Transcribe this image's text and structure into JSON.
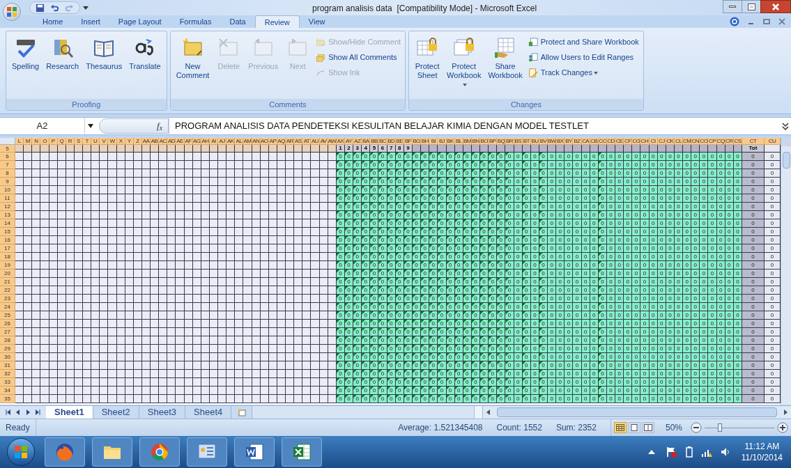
{
  "window": {
    "title": "program analisis data  [Compatibility Mode] - Microsoft Excel"
  },
  "ribbon_tabs": [
    {
      "label": "Home",
      "selected": false
    },
    {
      "label": "Insert",
      "selected": false
    },
    {
      "label": "Page Layout",
      "selected": false
    },
    {
      "label": "Formulas",
      "selected": false
    },
    {
      "label": "Data",
      "selected": false
    },
    {
      "label": "Review",
      "selected": true
    },
    {
      "label": "View",
      "selected": false
    }
  ],
  "groups": [
    {
      "label": "Proofing",
      "large": [
        {
          "label": "Spelling",
          "disabled": false,
          "dropdown": false
        },
        {
          "label": "Research",
          "disabled": false,
          "dropdown": false
        },
        {
          "label": "Thesaurus",
          "disabled": false,
          "dropdown": false
        },
        {
          "label": "Translate",
          "disabled": false,
          "dropdown": false
        }
      ]
    },
    {
      "label": "Comments",
      "large": [
        {
          "label": "New Comment",
          "disabled": false,
          "dropdown": false
        },
        {
          "label": "Delete",
          "disabled": true,
          "dropdown": false
        },
        {
          "label": "Previous",
          "disabled": true,
          "dropdown": false
        },
        {
          "label": "Next",
          "disabled": true,
          "dropdown": false
        }
      ],
      "small": [
        {
          "label": "Show/Hide Comment",
          "disabled": true,
          "dropdown": false
        },
        {
          "label": "Show All Comments",
          "disabled": false,
          "dropdown": false
        },
        {
          "label": "Show Ink",
          "disabled": true,
          "dropdown": false
        }
      ]
    },
    {
      "label": "Changes",
      "large": [
        {
          "label": "Protect Sheet",
          "disabled": false,
          "dropdown": false
        },
        {
          "label": "Protect Workbook",
          "disabled": false,
          "dropdown": true
        },
        {
          "label": "Share Workbook",
          "disabled": false,
          "dropdown": false
        }
      ],
      "small": [
        {
          "label": "Protect and Share Workbook",
          "disabled": false,
          "dropdown": false
        },
        {
          "label": "Allow Users to Edit Ranges",
          "disabled": false,
          "dropdown": false
        },
        {
          "label": "Track Changes",
          "disabled": false,
          "dropdown": true
        }
      ]
    }
  ],
  "formula_bar": {
    "name_box": "A2",
    "fx": "f$_{x}$",
    "value": "PROGRAM ANALISIS DATA PENDETEKSI KESULITAN BELAJAR KIMIA DENGAN MODEL TESTLET"
  },
  "grid": {
    "columns": [
      {
        "label": "L",
        "kind": "plain"
      },
      {
        "label": "M",
        "kind": "plain"
      },
      {
        "label": "N",
        "kind": "plain"
      },
      {
        "label": "O",
        "kind": "plain"
      },
      {
        "label": "P",
        "kind": "plain"
      },
      {
        "label": "Q",
        "kind": "plain"
      },
      {
        "label": "R",
        "kind": "plain"
      },
      {
        "label": "S",
        "kind": "plain"
      },
      {
        "label": "T",
        "kind": "plain"
      },
      {
        "label": "U",
        "kind": "plain"
      },
      {
        "label": "V",
        "kind": "plain"
      },
      {
        "label": "W",
        "kind": "plain"
      },
      {
        "label": "X",
        "kind": "plain"
      },
      {
        "label": "Y",
        "kind": "plain"
      },
      {
        "label": "Z",
        "kind": "plain"
      },
      {
        "label": "AA",
        "kind": "plain"
      },
      {
        "label": "AB",
        "kind": "plain"
      },
      {
        "label": "AC",
        "kind": "plain"
      },
      {
        "label": "AD",
        "kind": "plain"
      },
      {
        "label": "AE",
        "kind": "plain"
      },
      {
        "label": "AF",
        "kind": "plain"
      },
      {
        "label": "AG",
        "kind": "plain"
      },
      {
        "label": "AH",
        "kind": "plain"
      },
      {
        "label": "AI",
        "kind": "plain"
      },
      {
        "label": "AJ",
        "kind": "plain"
      },
      {
        "label": "AK",
        "kind": "plain"
      },
      {
        "label": "AL",
        "kind": "plain"
      },
      {
        "label": "AM",
        "kind": "plain"
      },
      {
        "label": "AN",
        "kind": "plain"
      },
      {
        "label": "AO",
        "kind": "plain"
      },
      {
        "label": "AP",
        "kind": "plain"
      },
      {
        "label": "AQ",
        "kind": "plain"
      },
      {
        "label": "AR",
        "kind": "plain"
      },
      {
        "label": "AS",
        "kind": "plain"
      },
      {
        "label": "AT",
        "kind": "plain"
      },
      {
        "label": "AU",
        "kind": "plain"
      },
      {
        "label": "AV",
        "kind": "plain"
      },
      {
        "label": "AW",
        "kind": "plain"
      },
      {
        "label": "AX",
        "kind": "answer",
        "flagged": true
      },
      {
        "label": "AY",
        "kind": "answer",
        "flagged": true
      },
      {
        "label": "AZ",
        "kind": "answer",
        "flagged": true
      },
      {
        "label": "BA",
        "kind": "answer",
        "flagged": true
      },
      {
        "label": "BB",
        "kind": "answer",
        "flagged": true
      },
      {
        "label": "BC",
        "kind": "answer",
        "flagged": true
      },
      {
        "label": "BD",
        "kind": "answer",
        "flagged": true
      },
      {
        "label": "BE",
        "kind": "answer",
        "flagged": true
      },
      {
        "label": "BF",
        "kind": "answer",
        "flagged": true
      },
      {
        "label": "BG",
        "kind": "answer",
        "flagged": true
      },
      {
        "label": "BH",
        "kind": "answer",
        "flagged": true
      },
      {
        "label": "BI",
        "kind": "answer",
        "flagged": true
      },
      {
        "label": "BJ",
        "kind": "answer",
        "flagged": true
      },
      {
        "label": "BK",
        "kind": "answer",
        "flagged": true
      },
      {
        "label": "BL",
        "kind": "answer",
        "flagged": true
      },
      {
        "label": "BM",
        "kind": "answer",
        "flagged": true
      },
      {
        "label": "BN",
        "kind": "answer",
        "flagged": true
      },
      {
        "label": "BO",
        "kind": "answer",
        "flagged": true
      },
      {
        "label": "BP",
        "kind": "answer",
        "flagged": true
      },
      {
        "label": "BQ",
        "kind": "answer",
        "flagged": true
      },
      {
        "label": "BR",
        "kind": "answer",
        "flagged": true
      },
      {
        "label": "BS",
        "kind": "answer",
        "flagged": false
      },
      {
        "label": "BT",
        "kind": "answer",
        "flagged": true
      },
      {
        "label": "BU",
        "kind": "answer",
        "flagged": false
      },
      {
        "label": "BV",
        "kind": "answer",
        "flagged": true
      },
      {
        "label": "BW",
        "kind": "answer",
        "flagged": false
      },
      {
        "label": "BX",
        "kind": "answer",
        "flagged": false
      },
      {
        "label": "BY",
        "kind": "answer",
        "flagged": false
      },
      {
        "label": "BZ",
        "kind": "answer",
        "flagged": false
      },
      {
        "label": "CA",
        "kind": "answer",
        "flagged": false
      },
      {
        "label": "CB",
        "kind": "answer",
        "flagged": false
      },
      {
        "label": "CC",
        "kind": "answer",
        "flagged": true
      },
      {
        "label": "CD",
        "kind": "answer",
        "flagged": false
      },
      {
        "label": "CE",
        "kind": "answer",
        "flagged": false
      },
      {
        "label": "CF",
        "kind": "answer",
        "flagged": false
      },
      {
        "label": "CG",
        "kind": "answer",
        "flagged": false
      },
      {
        "label": "CH",
        "kind": "answer",
        "flagged": false
      },
      {
        "label": "CI",
        "kind": "answer",
        "flagged": false
      },
      {
        "label": "CJ",
        "kind": "answer",
        "flagged": false
      },
      {
        "label": "CK",
        "kind": "answer",
        "flagged": false
      },
      {
        "label": "CL",
        "kind": "answer",
        "flagged": false
      },
      {
        "label": "CM",
        "kind": "answer",
        "flagged": false
      },
      {
        "label": "CN",
        "kind": "answer",
        "flagged": false
      },
      {
        "label": "CO",
        "kind": "answer",
        "flagged": false
      },
      {
        "label": "CP",
        "kind": "answer",
        "flagged": false
      },
      {
        "label": "CQ",
        "kind": "answer",
        "flagged": false
      },
      {
        "label": "CR",
        "kind": "answer",
        "flagged": false
      },
      {
        "label": "CS",
        "kind": "answer",
        "flagged": false
      },
      {
        "label": "CT",
        "kind": "total"
      },
      {
        "label": "CU",
        "kind": "extra"
      }
    ],
    "header_row": {
      "number": "5",
      "item_numbers": [
        "1",
        "2",
        "3",
        "4",
        "5",
        "6",
        "7",
        "8",
        "9"
      ],
      "total_label": "Tot"
    },
    "rows": [
      {
        "number": "6",
        "values": [
          "0",
          "0",
          "0",
          "0",
          "0",
          "0",
          "0",
          "0",
          "0",
          "0",
          "0",
          "0",
          "0",
          "0",
          "0",
          "0",
          "0",
          "0",
          "0",
          "0",
          "0",
          "0",
          "0",
          "0",
          "0",
          "0",
          "0",
          "0",
          "0",
          "0",
          "0",
          "0",
          "0",
          "0",
          "0",
          "0",
          "0",
          "0",
          "0",
          "0",
          "0",
          "0",
          "0",
          "0",
          "0",
          "0",
          "0",
          "0",
          "0",
          "0"
        ]
      },
      {
        "number": "7",
        "values": [
          "0",
          "0",
          "0",
          "0",
          "0",
          "0",
          "0",
          "0",
          "0",
          "0",
          "0",
          "0",
          "0",
          "0",
          "0",
          "0",
          "0",
          "0",
          "0",
          "0",
          "0",
          "0",
          "0",
          "0",
          "0",
          "0",
          "0",
          "0",
          "0",
          "0",
          "0",
          "0",
          "0",
          "0",
          "0",
          "0",
          "0",
          "0",
          "0",
          "0",
          "0",
          "0",
          "0",
          "0",
          "0",
          "0",
          "0",
          "0",
          "0",
          "0"
        ]
      },
      {
        "number": "8",
        "values": [
          "0",
          "0",
          "0",
          "0",
          "0",
          "0",
          "0",
          "0",
          "0",
          "0",
          "0",
          "0",
          "0",
          "0",
          "0",
          "0",
          "0",
          "0",
          "0",
          "0",
          "0",
          "0",
          "0",
          "0",
          "0",
          "0",
          "0",
          "0",
          "0",
          "0",
          "0",
          "0",
          "0",
          "0",
          "0",
          "0",
          "0",
          "0",
          "0",
          "0",
          "0",
          "0",
          "0",
          "0",
          "0",
          "0",
          "0",
          "0",
          "0",
          "0"
        ]
      },
      {
        "number": "9",
        "values": [
          "0",
          "0",
          "0",
          "0",
          "0",
          "0",
          "0",
          "0",
          "0",
          "0",
          "0",
          "0",
          "0",
          "0",
          "0",
          "0",
          "0",
          "0",
          "0",
          "0",
          "0",
          "0",
          "0",
          "0",
          "0",
          "0",
          "0",
          "0",
          "0",
          "0",
          "0",
          "0",
          "0",
          "0",
          "0",
          "0",
          "0",
          "0",
          "0",
          "0",
          "0",
          "0",
          "0",
          "0",
          "0",
          "0",
          "0",
          "0",
          "0",
          "0"
        ]
      },
      {
        "number": "10",
        "values": [
          "0",
          "0",
          "0",
          "0",
          "0",
          "0",
          "0",
          "0",
          "0",
          "0",
          "0",
          "0",
          "0",
          "0",
          "0",
          "0",
          "0",
          "0",
          "0",
          "0",
          "0",
          "0",
          "0",
          "0",
          "0",
          "0",
          "0",
          "0",
          "0",
          "0",
          "0",
          "0",
          "0",
          "0",
          "0",
          "0",
          "0",
          "0",
          "0",
          "0",
          "0",
          "0",
          "0",
          "0",
          "0",
          "0",
          "0",
          "0",
          "0",
          "0"
        ]
      },
      {
        "number": "11",
        "values": [
          "0",
          "0",
          "0",
          "0",
          "0",
          "0",
          "0",
          "0",
          "0",
          "0",
          "0",
          "0",
          "0",
          "0",
          "0",
          "0",
          "0",
          "0",
          "0",
          "0",
          "0",
          "0",
          "0",
          "0",
          "0",
          "0",
          "0",
          "0",
          "0",
          "0",
          "0",
          "0",
          "0",
          "0",
          "0",
          "0",
          "0",
          "0",
          "0",
          "0",
          "0",
          "0",
          "0",
          "0",
          "0",
          "0",
          "0",
          "0",
          "0",
          "0"
        ]
      },
      {
        "number": "12",
        "values": [
          "0",
          "0",
          "0",
          "0",
          "0",
          "0",
          "0",
          "0",
          "0",
          "0",
          "0",
          "0",
          "0",
          "0",
          "0",
          "0",
          "0",
          "0",
          "0",
          "0",
          "0",
          "0",
          "0",
          "0",
          "0",
          "0",
          "0",
          "0",
          "0",
          "0",
          "0",
          "0",
          "0",
          "0",
          "0",
          "0",
          "0",
          "0",
          "0",
          "0",
          "0",
          "0",
          "0",
          "0",
          "0",
          "0",
          "0",
          "0",
          "0",
          "0"
        ]
      },
      {
        "number": "13",
        "values": [
          "0",
          "0",
          "0",
          "0",
          "0",
          "0",
          "0",
          "0",
          "0",
          "0",
          "0",
          "0",
          "0",
          "0",
          "0",
          "0",
          "0",
          "0",
          "0",
          "0",
          "0",
          "0",
          "0",
          "0",
          "0",
          "0",
          "0",
          "0",
          "0",
          "0",
          "0",
          "0",
          "0",
          "0",
          "0",
          "0",
          "0",
          "0",
          "0",
          "0",
          "0",
          "0",
          "0",
          "0",
          "0",
          "0",
          "0",
          "0",
          "0",
          "0"
        ]
      },
      {
        "number": "14",
        "values": [
          "0",
          "0",
          "0",
          "0",
          "0",
          "0",
          "0",
          "0",
          "0",
          "0",
          "0",
          "0",
          "0",
          "0",
          "0",
          "0",
          "0",
          "0",
          "0",
          "0",
          "0",
          "0",
          "0",
          "0",
          "0",
          "0",
          "0",
          "0",
          "0",
          "0",
          "0",
          "0",
          "0",
          "0",
          "0",
          "0",
          "0",
          "0",
          "0",
          "0",
          "0",
          "0",
          "0",
          "0",
          "0",
          "0",
          "0",
          "0",
          "0",
          "0"
        ]
      },
      {
        "number": "15",
        "values": [
          "0",
          "0",
          "0",
          "0",
          "0",
          "0",
          "0",
          "0",
          "0",
          "0",
          "0",
          "0",
          "0",
          "0",
          "0",
          "0",
          "0",
          "0",
          "0",
          "0",
          "0",
          "0",
          "0",
          "0",
          "0",
          "0",
          "0",
          "0",
          "0",
          "0",
          "0",
          "0",
          "0",
          "0",
          "0",
          "0",
          "0",
          "0",
          "0",
          "0",
          "0",
          "0",
          "0",
          "0",
          "0",
          "0",
          "0",
          "0",
          "0",
          "0"
        ]
      },
      {
        "number": "16",
        "values": [
          "0",
          "0",
          "0",
          "0",
          "0",
          "0",
          "0",
          "0",
          "0",
          "0",
          "0",
          "0",
          "0",
          "0",
          "0",
          "0",
          "0",
          "0",
          "0",
          "0",
          "0",
          "0",
          "0",
          "0",
          "0",
          "0",
          "0",
          "0",
          "0",
          "0",
          "0",
          "0",
          "0",
          "0",
          "0",
          "0",
          "0",
          "0",
          "0",
          "0",
          "0",
          "0",
          "0",
          "0",
          "0",
          "0",
          "0",
          "0",
          "0",
          "0"
        ]
      },
      {
        "number": "17",
        "values": [
          "0",
          "0",
          "0",
          "0",
          "0",
          "0",
          "0",
          "0",
          "0",
          "0",
          "0",
          "0",
          "0",
          "0",
          "0",
          "0",
          "0",
          "0",
          "0",
          "0",
          "0",
          "0",
          "0",
          "0",
          "0",
          "0",
          "0",
          "0",
          "0",
          "0",
          "0",
          "0",
          "0",
          "0",
          "0",
          "0",
          "0",
          "0",
          "0",
          "0",
          "0",
          "0",
          "0",
          "0",
          "0",
          "0",
          "0",
          "0",
          "0",
          "0"
        ]
      },
      {
        "number": "18",
        "values": [
          "0",
          "0",
          "0",
          "0",
          "0",
          "0",
          "0",
          "0",
          "0",
          "0",
          "0",
          "0",
          "0",
          "0",
          "0",
          "0",
          "0",
          "0",
          "0",
          "0",
          "0",
          "0",
          "0",
          "0",
          "0",
          "0",
          "0",
          "0",
          "0",
          "0",
          "0",
          "0",
          "0",
          "0",
          "0",
          "0",
          "0",
          "0",
          "0",
          "0",
          "0",
          "0",
          "0",
          "0",
          "0",
          "0",
          "0",
          "0",
          "0",
          "0"
        ]
      },
      {
        "number": "19",
        "values": [
          "0",
          "0",
          "0",
          "0",
          "0",
          "0",
          "0",
          "0",
          "0",
          "0",
          "0",
          "0",
          "0",
          "0",
          "0",
          "0",
          "0",
          "0",
          "0",
          "0",
          "0",
          "0",
          "0",
          "0",
          "0",
          "0",
          "0",
          "0",
          "0",
          "0",
          "0",
          "0",
          "0",
          "0",
          "0",
          "0",
          "0",
          "0",
          "0",
          "0",
          "0",
          "0",
          "0",
          "0",
          "0",
          "0",
          "0",
          "0",
          "0",
          "0"
        ]
      },
      {
        "number": "20",
        "values": [
          "0",
          "0",
          "0",
          "0",
          "0",
          "0",
          "0",
          "0",
          "0",
          "0",
          "0",
          "0",
          "0",
          "0",
          "0",
          "0",
          "0",
          "0",
          "0",
          "0",
          "0",
          "0",
          "0",
          "0",
          "0",
          "0",
          "0",
          "0",
          "0",
          "0",
          "0",
          "0",
          "0",
          "0",
          "0",
          "0",
          "0",
          "0",
          "0",
          "0",
          "0",
          "0",
          "0",
          "0",
          "0",
          "0",
          "0",
          "0",
          "0",
          "0"
        ]
      },
      {
        "number": "21",
        "values": [
          "0",
          "0",
          "0",
          "0",
          "0",
          "0",
          "0",
          "0",
          "0",
          "0",
          "0",
          "0",
          "0",
          "0",
          "0",
          "0",
          "0",
          "0",
          "0",
          "0",
          "0",
          "0",
          "0",
          "0",
          "0",
          "0",
          "0",
          "0",
          "0",
          "0",
          "0",
          "0",
          "0",
          "0",
          "0",
          "0",
          "0",
          "0",
          "0",
          "0",
          "0",
          "0",
          "0",
          "0",
          "0",
          "0",
          "0",
          "0",
          "0",
          "0"
        ]
      },
      {
        "number": "22",
        "values": [
          "0",
          "0",
          "0",
          "0",
          "0",
          "0",
          "0",
          "0",
          "0",
          "0",
          "0",
          "0",
          "0",
          "0",
          "0",
          "0",
          "0",
          "0",
          "0",
          "0",
          "0",
          "0",
          "0",
          "0",
          "0",
          "0",
          "0",
          "0",
          "0",
          "0",
          "0",
          "0",
          "0",
          "0",
          "0",
          "0",
          "0",
          "0",
          "0",
          "0",
          "0",
          "0",
          "0",
          "0",
          "0",
          "0",
          "0",
          "0",
          "0",
          "0"
        ]
      },
      {
        "number": "23",
        "values": [
          "0",
          "0",
          "0",
          "0",
          "0",
          "0",
          "0",
          "0",
          "0",
          "0",
          "0",
          "0",
          "0",
          "0",
          "0",
          "0",
          "0",
          "0",
          "0",
          "0",
          "0",
          "0",
          "0",
          "0",
          "0",
          "0",
          "0",
          "0",
          "0",
          "0",
          "0",
          "0",
          "0",
          "0",
          "0",
          "0",
          "0",
          "0",
          "0",
          "0",
          "0",
          "0",
          "0",
          "0",
          "0",
          "0",
          "0",
          "0",
          "0",
          "0"
        ]
      },
      {
        "number": "24",
        "values": [
          "0",
          "0",
          "0",
          "0",
          "0",
          "0",
          "0",
          "0",
          "0",
          "0",
          "0",
          "0",
          "0",
          "0",
          "0",
          "0",
          "0",
          "0",
          "0",
          "0",
          "0",
          "0",
          "0",
          "0",
          "0",
          "0",
          "0",
          "0",
          "0",
          "0",
          "0",
          "0",
          "0",
          "0",
          "0",
          "0",
          "0",
          "0",
          "0",
          "0",
          "0",
          "0",
          "0",
          "0",
          "0",
          "0",
          "0",
          "0",
          "0",
          "0"
        ]
      },
      {
        "number": "25",
        "values": [
          "0",
          "0",
          "0",
          "0",
          "0",
          "0",
          "0",
          "0",
          "0",
          "0",
          "0",
          "0",
          "0",
          "0",
          "0",
          "0",
          "0",
          "0",
          "0",
          "0",
          "0",
          "0",
          "0",
          "0",
          "0",
          "0",
          "0",
          "0",
          "0",
          "0",
          "0",
          "0",
          "0",
          "0",
          "0",
          "0",
          "0",
          "0",
          "0",
          "0",
          "0",
          "0",
          "0",
          "0",
          "0",
          "0",
          "0",
          "0",
          "0",
          "0"
        ]
      },
      {
        "number": "26",
        "values": [
          "0",
          "0",
          "0",
          "0",
          "0",
          "0",
          "0",
          "0",
          "0",
          "0",
          "0",
          "0",
          "0",
          "0",
          "0",
          "0",
          "0",
          "0",
          "0",
          "0",
          "0",
          "0",
          "0",
          "0",
          "0",
          "0",
          "0",
          "0",
          "0",
          "0",
          "0",
          "0",
          "0",
          "0",
          "0",
          "0",
          "0",
          "0",
          "0",
          "0",
          "0",
          "0",
          "0",
          "0",
          "0",
          "0",
          "0",
          "0",
          "0",
          "0"
        ]
      },
      {
        "number": "27",
        "values": [
          "0",
          "0",
          "0",
          "0",
          "0",
          "0",
          "0",
          "0",
          "0",
          "0",
          "0",
          "0",
          "0",
          "0",
          "0",
          "0",
          "0",
          "0",
          "0",
          "0",
          "0",
          "0",
          "0",
          "0",
          "0",
          "0",
          "0",
          "0",
          "0",
          "0",
          "0",
          "0",
          "0",
          "0",
          "0",
          "0",
          "0",
          "0",
          "0",
          "0",
          "0",
          "0",
          "0",
          "0",
          "0",
          "0",
          "0",
          "0",
          "0",
          "0"
        ]
      },
      {
        "number": "28",
        "values": [
          "0",
          "0",
          "0",
          "0",
          "0",
          "0",
          "0",
          "0",
          "0",
          "0",
          "0",
          "0",
          "0",
          "0",
          "0",
          "0",
          "0",
          "0",
          "0",
          "0",
          "0",
          "0",
          "0",
          "0",
          "0",
          "0",
          "0",
          "0",
          "0",
          "0",
          "0",
          "0",
          "0",
          "0",
          "0",
          "0",
          "0",
          "0",
          "0",
          "0",
          "0",
          "0",
          "0",
          "0",
          "0",
          "0",
          "0",
          "0",
          "0",
          "0"
        ]
      },
      {
        "number": "29",
        "values": [
          "0",
          "0",
          "0",
          "0",
          "0",
          "0",
          "0",
          "0",
          "0",
          "0",
          "0",
          "0",
          "0",
          "0",
          "0",
          "0",
          "0",
          "0",
          "0",
          "0",
          "0",
          "0",
          "0",
          "0",
          "0",
          "0",
          "0",
          "0",
          "0",
          "0",
          "0",
          "0",
          "0",
          "0",
          "0",
          "0",
          "0",
          "0",
          "0",
          "0",
          "0",
          "0",
          "0",
          "0",
          "0",
          "0",
          "0",
          "0",
          "0",
          "0"
        ]
      },
      {
        "number": "30",
        "values": [
          "0",
          "0",
          "0",
          "0",
          "0",
          "0",
          "0",
          "0",
          "0",
          "0",
          "0",
          "0",
          "0",
          "0",
          "0",
          "0",
          "0",
          "0",
          "0",
          "0",
          "0",
          "0",
          "0",
          "0",
          "0",
          "0",
          "0",
          "0",
          "0",
          "0",
          "0",
          "0",
          "0",
          "0",
          "0",
          "0",
          "0",
          "0",
          "0",
          "0",
          "0",
          "0",
          "0",
          "0",
          "0",
          "0",
          "0",
          "0",
          "0",
          "0"
        ]
      },
      {
        "number": "31",
        "values": [
          "0",
          "0",
          "0",
          "0",
          "0",
          "0",
          "0",
          "0",
          "0",
          "0",
          "0",
          "0",
          "0",
          "0",
          "0",
          "0",
          "0",
          "0",
          "0",
          "0",
          "0",
          "0",
          "0",
          "0",
          "0",
          "0",
          "0",
          "0",
          "0",
          "0",
          "0",
          "0",
          "0",
          "0",
          "0",
          "0",
          "0",
          "0",
          "0",
          "0",
          "0",
          "0",
          "0",
          "0",
          "0",
          "0",
          "0",
          "0",
          "0",
          "0"
        ]
      },
      {
        "number": "32",
        "values": [
          "0",
          "0",
          "0",
          "0",
          "0",
          "0",
          "0",
          "0",
          "0",
          "0",
          "0",
          "0",
          "0",
          "0",
          "0",
          "0",
          "0",
          "0",
          "0",
          "0",
          "0",
          "0",
          "0",
          "0",
          "0",
          "0",
          "0",
          "0",
          "0",
          "0",
          "0",
          "0",
          "0",
          "0",
          "0",
          "0",
          "0",
          "0",
          "0",
          "0",
          "0",
          "0",
          "0",
          "0",
          "0",
          "0",
          "0",
          "0",
          "0",
          "0"
        ]
      },
      {
        "number": "33",
        "values": [
          "0",
          "0",
          "0",
          "0",
          "0",
          "0",
          "0",
          "0",
          "0",
          "0",
          "0",
          "0",
          "0",
          "0",
          "0",
          "0",
          "0",
          "0",
          "0",
          "0",
          "0",
          "0",
          "0",
          "0",
          "0",
          "0",
          "0",
          "0",
          "0",
          "0",
          "0",
          "0",
          "0",
          "0",
          "0",
          "0",
          "0",
          "0",
          "0",
          "0",
          "0",
          "0",
          "0",
          "0",
          "0",
          "0",
          "0",
          "0",
          "0",
          "0"
        ]
      },
      {
        "number": "34",
        "values": [
          "0",
          "0",
          "0",
          "0",
          "0",
          "0",
          "0",
          "0",
          "0",
          "0",
          "0",
          "0",
          "0",
          "0",
          "0",
          "0",
          "0",
          "0",
          "0",
          "0",
          "0",
          "0",
          "0",
          "0",
          "0",
          "0",
          "0",
          "0",
          "0",
          "0",
          "0",
          "0",
          "0",
          "0",
          "0",
          "0",
          "0",
          "0",
          "0",
          "0",
          "0",
          "0",
          "0",
          "0",
          "0",
          "0",
          "0",
          "0",
          "0",
          "0"
        ]
      },
      {
        "number": "35",
        "values": [
          "0",
          "0",
          "0",
          "0",
          "0",
          "0",
          "0",
          "0",
          "0",
          "0",
          "0",
          "0",
          "0",
          "0",
          "0",
          "0",
          "0",
          "0",
          "0",
          "0",
          "0",
          "0",
          "0",
          "0",
          "0",
          "0",
          "0",
          "0",
          "0",
          "0",
          "0",
          "0",
          "0",
          "0",
          "0",
          "0",
          "0",
          "0",
          "0",
          "0",
          "0",
          "0",
          "0",
          "0",
          "0",
          "0",
          "0",
          "0",
          "0",
          "0"
        ]
      }
    ]
  },
  "sheet_tabs": [
    {
      "label": "Sheet1",
      "selected": true
    },
    {
      "label": "Sheet2",
      "selected": false
    },
    {
      "label": "Sheet3",
      "selected": false
    },
    {
      "label": "Sheet4",
      "selected": false
    }
  ],
  "status_bar": {
    "mode": "Ready",
    "stats": [
      "Average: 1.521345408",
      "Count: 1552",
      "Sum: 2352"
    ],
    "views": [
      {
        "kind": "normal",
        "selected": true
      },
      {
        "kind": "layout",
        "selected": false
      },
      {
        "kind": "break",
        "selected": false
      }
    ],
    "zoom": "50%",
    "zoom_slider": {
      "level": 0.22
    }
  },
  "taskbar": {
    "apps": [
      {
        "kind": "firefox"
      },
      {
        "kind": "folder"
      },
      {
        "kind": "chrome"
      },
      {
        "kind": "panel"
      },
      {
        "kind": "word"
      },
      {
        "kind": "excel"
      }
    ],
    "time": "11:12 AM",
    "date": "11/10/2014"
  }
}
